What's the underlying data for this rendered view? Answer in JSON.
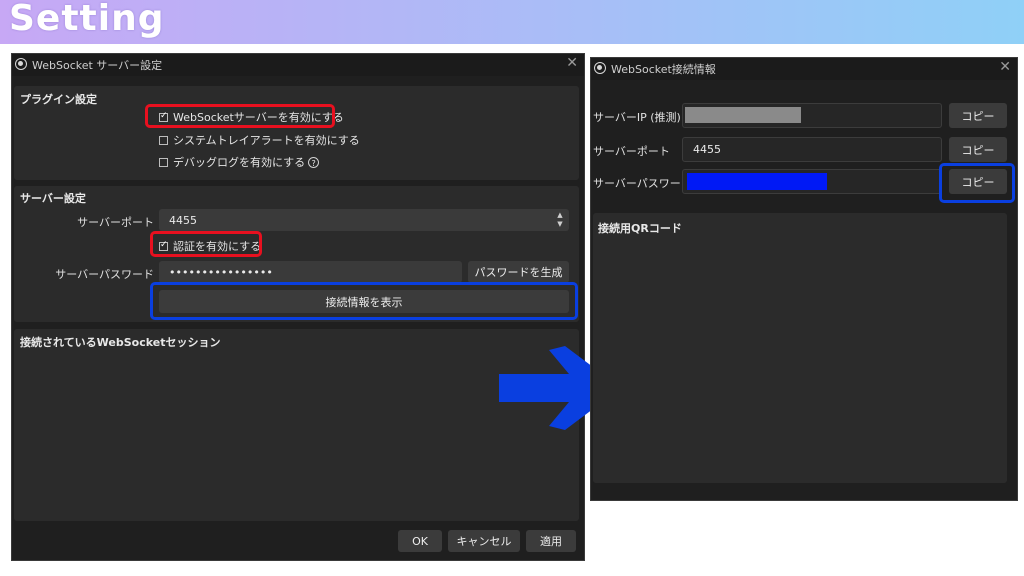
{
  "banner": {
    "title": "Setting"
  },
  "settings_window": {
    "title": "WebSocket サーバー設定",
    "close_glyph": "✕",
    "plugin_group": {
      "label": "プラグイン設定",
      "enable_server": "WebSocketサーバーを有効にする",
      "system_tray": "システムトレイアラートを有効にする",
      "debug_log": "デバッグログを有効にする",
      "help_glyph": "?"
    },
    "server_group": {
      "label": "サーバー設定",
      "port_label": "サーバーポート",
      "port_value": "4455",
      "auth_label": "認証を有効にする",
      "password_label": "サーバーパスワード",
      "password_value": "••••••••••••••••",
      "generate_button": "パスワードを生成",
      "show_info_button": "接続情報を表示"
    },
    "sessions_group": {
      "label": "接続されているWebSocketセッション"
    },
    "footer": {
      "ok": "OK",
      "cancel": "キャンセル",
      "apply": "適用"
    }
  },
  "info_window": {
    "title": "WebSocket接続情報",
    "close_glyph": "✕",
    "ip_label": "サーバーIP (推測)",
    "port_label": "サーバーポート",
    "port_value": "4455",
    "password_label": "サーバーパスワード",
    "copy_label": "コピー",
    "qr_label": "接続用QRコード"
  },
  "colors": {
    "highlight_red": "#e8101f",
    "highlight_blue": "#0a3fe0",
    "arrow_blue": "#0a3fe0",
    "redact_gray": "#8a8a8a",
    "redact_blue": "#0019f5"
  }
}
